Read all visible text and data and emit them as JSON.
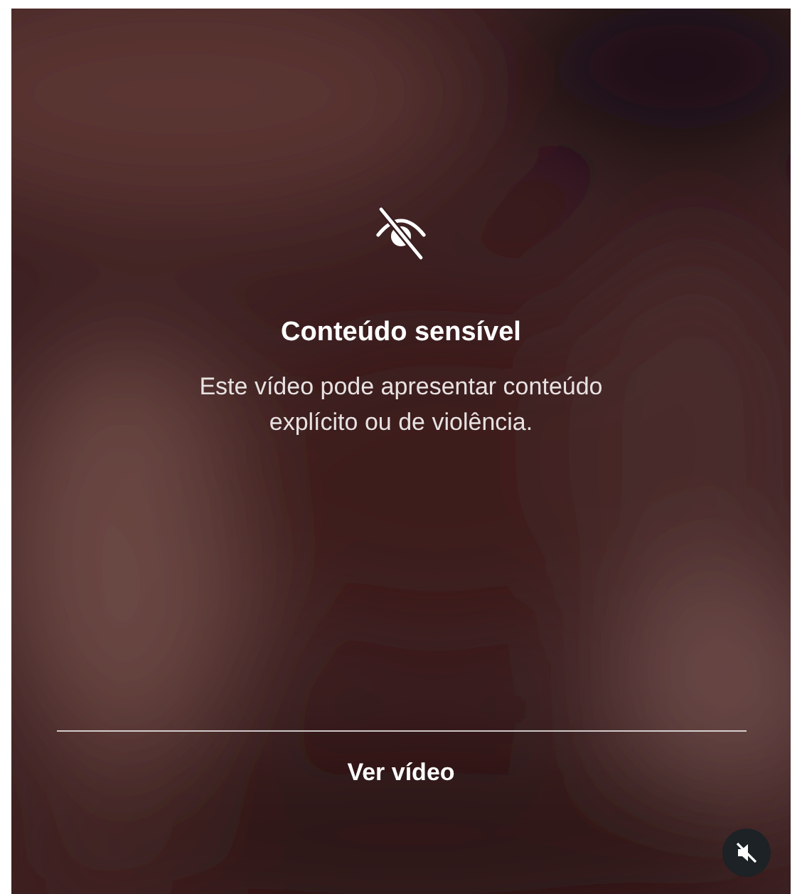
{
  "warning": {
    "title": "Conteúdo sensível",
    "message": "Este vídeo pode apresentar conteúdo explícito ou de violência."
  },
  "action": {
    "label": "Ver vídeo"
  },
  "sound": {
    "muted": true
  }
}
